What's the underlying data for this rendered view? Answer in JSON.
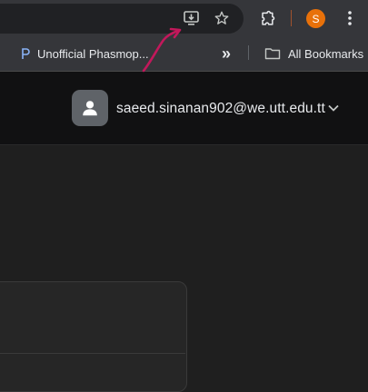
{
  "browser": {
    "profile_initial": "S",
    "icons": {
      "install": "install-app-icon",
      "bookmark": "star-icon",
      "extensions": "puzzle-icon",
      "menu": "kebab-menu-icon"
    }
  },
  "bookmarks_bar": {
    "items": [
      {
        "label": "Unofficial Phasmop...",
        "icon": "phasmophobia-favicon"
      }
    ],
    "overflow_label": "»",
    "all_bookmarks_label": "All Bookmarks"
  },
  "app": {
    "user_email": "saeed.sinanan902@we.utt.edu.tt"
  },
  "colors": {
    "profile_avatar": "#e8710a",
    "annotation_arrow": "#c2185b"
  }
}
